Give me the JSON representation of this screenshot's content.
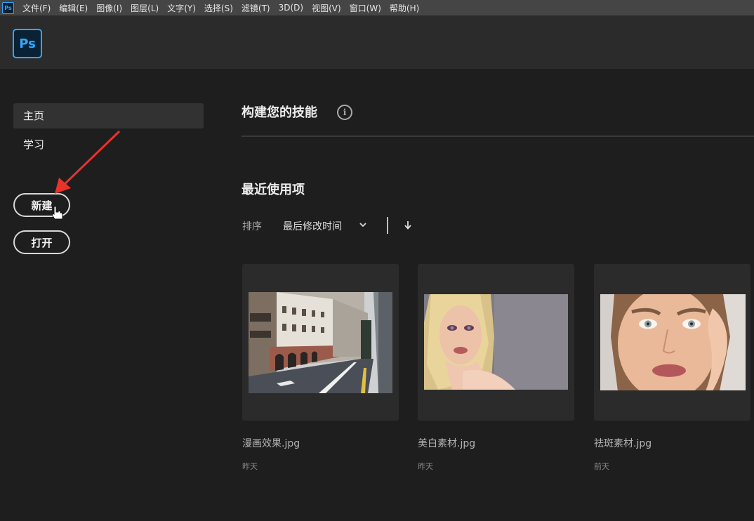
{
  "menubar": {
    "app_icon": "Ps",
    "items": [
      "文件(F)",
      "编辑(E)",
      "图像(I)",
      "图层(L)",
      "文字(Y)",
      "选择(S)",
      "滤镜(T)",
      "3D(D)",
      "视图(V)",
      "窗口(W)",
      "帮助(H)"
    ]
  },
  "header": {
    "logo": "Ps"
  },
  "sidebar": {
    "home": "主页",
    "learn": "学习",
    "new_button": "新建",
    "open_button": "打开"
  },
  "main": {
    "skills_title": "构建您的技能",
    "info_icon": "i",
    "recent_title": "最近使用项",
    "sort_label": "排序",
    "sort_value": "最后修改时间",
    "files": [
      {
        "name": "漫画效果.jpg",
        "time": "昨天"
      },
      {
        "name": "美白素材.jpg",
        "time": "昨天"
      },
      {
        "name": "祛斑素材.jpg",
        "time": "前天"
      }
    ]
  },
  "colors": {
    "accent": "#31a8ff",
    "annotation_arrow": "#e8332b"
  }
}
